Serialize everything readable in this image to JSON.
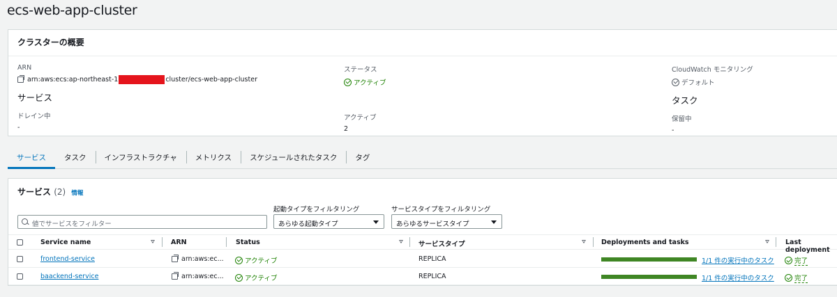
{
  "page": {
    "title": "ecs-web-app-cluster"
  },
  "overview": {
    "header": "クラスターの概要",
    "arn_label": "ARN",
    "arn_prefix": "arn:aws:ecs:ap-northeast-1",
    "arn_suffix": "cluster/ecs-web-app-cluster",
    "status_label": "ステータス",
    "status_value": "アクティブ",
    "cloudwatch_label": "CloudWatch モニタリング",
    "cloudwatch_value": "デフォルト",
    "services_heading": "サービス",
    "tasks_heading": "タスク",
    "draining_label": "ドレイン中",
    "draining_value": "-",
    "active_label": "アクティブ",
    "active_value": "2",
    "pending_label": "保留中",
    "pending_value": "-"
  },
  "tabs": [
    {
      "label": "サービス",
      "active": true
    },
    {
      "label": "タスク"
    },
    {
      "label": "インフラストラクチャ"
    },
    {
      "label": "メトリクス"
    },
    {
      "label": "スケジュールされたタスク"
    },
    {
      "label": "タグ"
    }
  ],
  "services": {
    "title": "サービス",
    "count": "(2)",
    "info": "情報",
    "search_placeholder": "値でサービスをフィルター",
    "launch_filter_label": "起動タイプをフィルタリング",
    "launch_filter_value": "あらゆる起動タイプ",
    "type_filter_label": "サービスタイプをフィルタリング",
    "type_filter_value": "あらゆるサービスタイプ",
    "columns": {
      "name": "Service name",
      "arn": "ARN",
      "status": "Status",
      "type": "サービスタイプ",
      "deployments": "Deployments and tasks",
      "last": "Last deployment"
    },
    "rows": [
      {
        "name": "frontend-service",
        "arn": "arn:aws:ec...",
        "status": "アクティブ",
        "type": "REPLICA",
        "progress": 1.0,
        "tasks": "1/1 件の実行中のタスク",
        "last": "完了"
      },
      {
        "name": "baackend-service",
        "arn": "arn:aws:ec...",
        "status": "アクティブ",
        "type": "REPLICA",
        "progress": 1.0,
        "tasks": "1/1 件の実行中のタスク",
        "last": "完了"
      }
    ]
  },
  "colors": {
    "accent": "#0073bb",
    "success": "#1d8102",
    "progress": "#3f8624",
    "redaction": "#e5141c"
  }
}
